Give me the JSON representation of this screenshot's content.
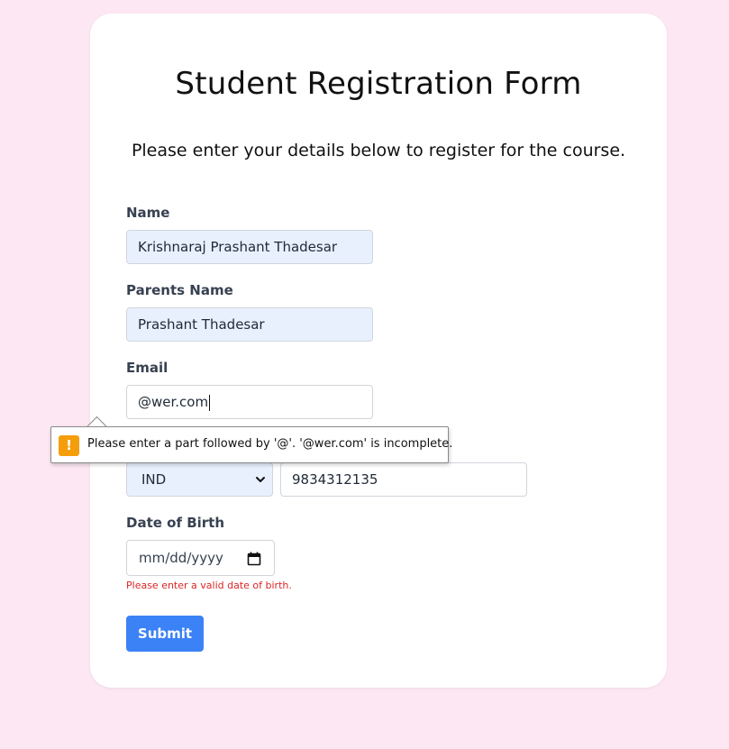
{
  "form": {
    "title": "Student Registration Form",
    "subtitle": "Please enter your details below to register for the course.",
    "name": {
      "label": "Name",
      "value": "Krishnaraj Prashant Thadesar"
    },
    "parents_name": {
      "label": "Parents Name",
      "value": "Prashant Thadesar"
    },
    "email": {
      "label": "Email",
      "value": "@wer.com"
    },
    "phone": {
      "country_code": "IND",
      "number": "9834312135"
    },
    "dob": {
      "label": "Date of Birth",
      "placeholder": "mm/dd/yyyy",
      "error": "Please enter a valid date of birth."
    },
    "submit_label": "Submit"
  },
  "validation_tooltip": {
    "message": "Please enter a part followed by '@'. '@wer.com' is incomplete.",
    "icon": "warning-icon",
    "icon_color": "#f59e0b"
  },
  "colors": {
    "page_background": "#fce7f3",
    "accent": "#3b82f6",
    "error": "#dc2626",
    "autofill": "#e8f0fe"
  }
}
